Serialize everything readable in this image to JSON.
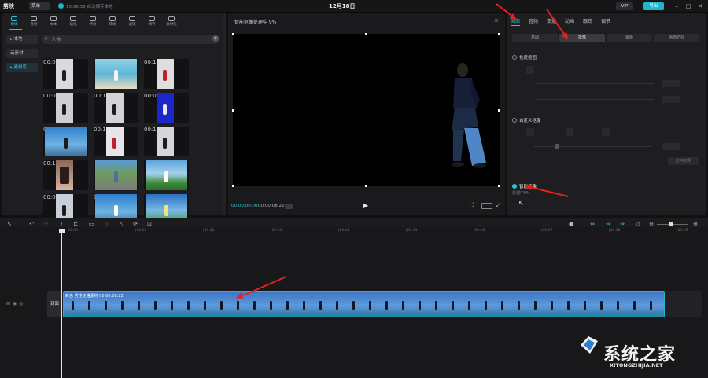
{
  "titlebar": {
    "app_name": "剪映",
    "menu_label": "菜单",
    "autosave_status": "15:06:55 自动保存本地",
    "project_title": "12月18日",
    "vip_label": "VIP",
    "export_label": "导出"
  },
  "media_toolbar": [
    {
      "label": "媒体",
      "icon": "media-icon",
      "active": true
    },
    {
      "label": "音频",
      "icon": "audio-icon",
      "active": false
    },
    {
      "label": "文本",
      "icon": "text-icon",
      "active": false
    },
    {
      "label": "贴纸",
      "icon": "sticker-icon",
      "active": false
    },
    {
      "label": "特效",
      "icon": "effects-icon",
      "active": false
    },
    {
      "label": "转场",
      "icon": "transition-icon",
      "active": false
    },
    {
      "label": "滤镜",
      "icon": "filter-icon",
      "active": false
    },
    {
      "label": "调节",
      "icon": "adjust-icon",
      "active": false
    },
    {
      "label": "素材包",
      "icon": "package-icon",
      "active": false
    }
  ],
  "media_sidebar": [
    {
      "label": "▸ 本地",
      "active": false
    },
    {
      "label": "云素材",
      "active": false
    },
    {
      "label": "▸ 素材库",
      "active": true
    }
  ],
  "search": {
    "value": "人物"
  },
  "thumbnails": [
    {
      "duration": "00:08",
      "bg": "#d9d9de",
      "download": false,
      "scene": "studio"
    },
    {
      "duration": "",
      "bg": "#7cc4dc",
      "download": false,
      "scene": "beach"
    },
    {
      "duration": "00:17",
      "bg": "#dedede",
      "download": false,
      "scene": "studio-red"
    },
    {
      "duration": "00:08",
      "bg": "#cfcfd2",
      "download": false,
      "scene": "studio"
    },
    {
      "duration": "00:18",
      "bg": "#d4d4d8",
      "download": true,
      "scene": "studio"
    },
    {
      "duration": "00:09",
      "bg": "#1b27c9",
      "download": true,
      "scene": "blue"
    },
    {
      "duration": "00:09",
      "bg": "#3f8ed2",
      "download": false,
      "scene": "sky"
    },
    {
      "duration": "00:13",
      "bg": "#e6e6ea",
      "download": false,
      "scene": "studio-red"
    },
    {
      "duration": "00:12",
      "bg": "#d6d6d8",
      "download": false,
      "scene": "studio"
    },
    {
      "duration": "00:12",
      "bg": "#c9a28a",
      "download": false,
      "scene": "portrait"
    },
    {
      "duration": "",
      "bg": "#5d8f55",
      "download": false,
      "scene": "road"
    },
    {
      "duration": "",
      "bg": "#6aa6d8",
      "download": false,
      "scene": "field"
    },
    {
      "duration": "00:09",
      "bg": "#c7cfd8",
      "download": false,
      "scene": "studio"
    },
    {
      "duration": "00:10",
      "bg": "#6ab1dc",
      "download": false,
      "scene": "sea"
    },
    {
      "duration": "",
      "bg": "#3d80c8",
      "download": false,
      "scene": "sunrise"
    }
  ],
  "preview": {
    "title": "智能抠像处理中 9%",
    "current_time": "00:00:00:00",
    "total_time": "00:00:08:22"
  },
  "props": {
    "tabs": [
      "画面",
      "音频",
      "变速",
      "动画",
      "跟踪",
      "调节"
    ],
    "active_tab": 0,
    "subtabs": [
      "基础",
      "抠像",
      "蒙版",
      "画面防抖"
    ],
    "active_subtab": 1,
    "chroma_key_label": "色度抠图",
    "custom_matting_label": "自定义抠像",
    "smart_matting_label": "智能抠像",
    "smart_matting_status": "处理中9%",
    "apply_effect_label": "应用效果"
  },
  "timeline": {
    "ruler": [
      "00:00",
      "|00:01",
      "|00:02",
      "|00:03",
      "|00:04",
      "|00:05",
      "|00:06",
      "|00:07",
      "|00:08",
      "|00:09"
    ],
    "clip_label": "彩色 男性走路素材   00:00:08:22",
    "cover_label": "封面"
  },
  "watermark": {
    "site_name": "系统之家",
    "site_url": "XITONGZHIJIA.NET"
  },
  "colors": {
    "accent": "#27c3d6",
    "annotation": "#e8201c"
  }
}
